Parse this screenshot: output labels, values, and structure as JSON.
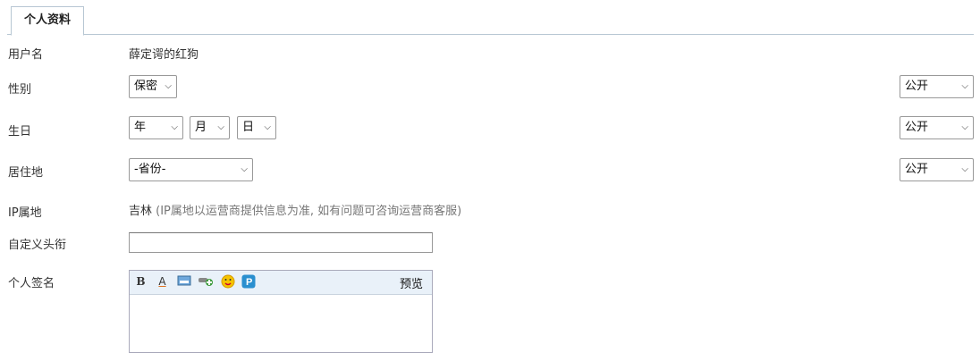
{
  "tab": {
    "label": "个人资料"
  },
  "fields": {
    "username": {
      "label": "用户名",
      "value": "薛定谔的红狗"
    },
    "gender": {
      "label": "性别",
      "value": "保密",
      "privacy": "公开"
    },
    "birthday": {
      "label": "生日",
      "year": "年",
      "month": "月",
      "day": "日",
      "privacy": "公开"
    },
    "residence": {
      "label": "居住地",
      "province": "-省份-",
      "privacy": "公开"
    },
    "ip_location": {
      "label": "IP属地",
      "value": "吉林",
      "note": "(IP属地以运营商提供信息为准, 如有问题可咨询运营商客服)"
    },
    "custom_title": {
      "label": "自定义头衔",
      "value": ""
    },
    "signature": {
      "label": "个人签名",
      "preview": "预览"
    }
  },
  "icons": [
    "bold-icon",
    "font-color-icon",
    "image-icon",
    "link-icon",
    "emoji-icon",
    "paypal-icon"
  ]
}
